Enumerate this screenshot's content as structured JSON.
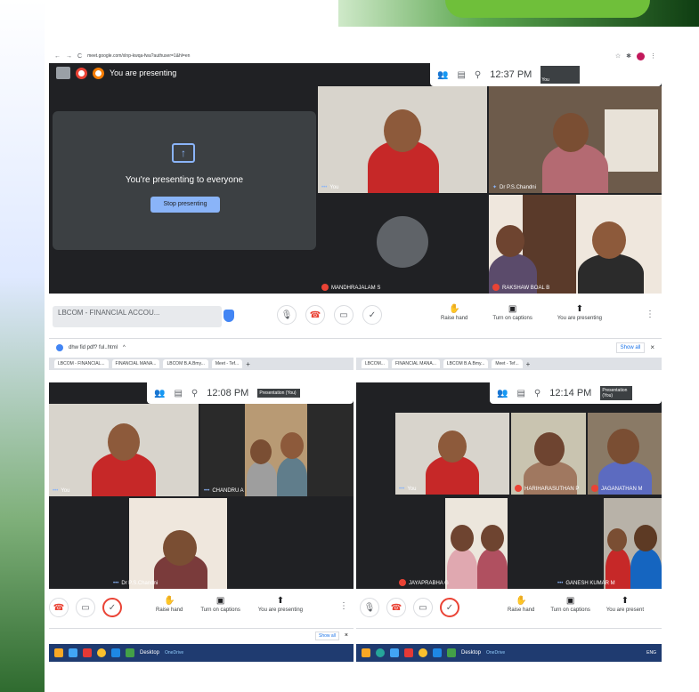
{
  "main": {
    "url": "meet.google.com/xlnp-kwqa-fwa?authuser=1&hl=en",
    "presenting_banner": "You are presenting",
    "time": "12:37 PM",
    "self_label": "Presentation (You)",
    "self_short": "You",
    "present_card": {
      "title": "You're presenting to everyone",
      "stop_button": "Stop presenting"
    },
    "tiles": [
      {
        "name": "You"
      },
      {
        "name": "Dr P.S.Chandni"
      },
      {
        "name": "MANDHRAJALAM S"
      },
      {
        "name": "RAKSHAW BOAL B"
      }
    ],
    "tab_title": "LBCOM - FINANCIAL ACCOU...",
    "actions": {
      "raise_hand": "Raise hand",
      "captions": "Turn on captions",
      "presenting": "You are presenting"
    },
    "download_file": "dhw fid pdf? ful..html",
    "show_all": "Show all"
  },
  "left": {
    "tabs": [
      "LBCOM - FINANCIAL...",
      "FINANCIAL MANA...",
      "LBCOM B.A.Bmy...",
      "Meet - Tef..."
    ],
    "time": "12:08 PM",
    "self_label": "Presentation (You)",
    "tiles": [
      {
        "name": "You"
      },
      {
        "name": "CHANDRU A"
      },
      {
        "name": "Dr P.S.Chandni"
      }
    ],
    "actions": {
      "raise_hand": "Raise hand",
      "captions": "Turn on captions",
      "presenting": "You are presenting"
    },
    "show_all": "Show all",
    "taskbar_label": "Desktop",
    "onedrive": "OneDrive"
  },
  "right": {
    "tabs": [
      "LBCOM...",
      "FINANCIAL MANA...",
      "LBCOM B.A.Bmy...",
      "Meet - Tef..."
    ],
    "time": "12:14 PM",
    "self_label": "Presentation (You)",
    "tiles": [
      {
        "name": "You"
      },
      {
        "name": "HARIHARASUTHAN P"
      },
      {
        "name": "JAGANATHAN M"
      },
      {
        "name": "JAYAPRABHA G"
      },
      {
        "name": "GANESH KUMAR M"
      }
    ],
    "actions": {
      "raise_hand": "Raise hand",
      "captions": "Turn on captions",
      "presenting": "You are present"
    },
    "taskbar_label": "Desktop",
    "onedrive": "OneDrive",
    "lang": "ENG"
  }
}
